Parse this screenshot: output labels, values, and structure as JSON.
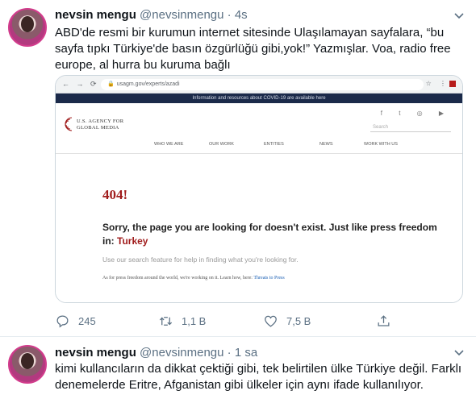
{
  "tweets": [
    {
      "name": "nevsin mengu",
      "handle": "@nevsinmengu",
      "separator": "·",
      "time": "4s",
      "text": "ABD'de resmi bir kurumun internet sitesinde Ulaşılamayan sayfalara, “bu sayfa tıpkı Türkiye'de basın özgürlüğü gibi,yok!” Yazmışlar. Voa, radio free europe, al hurra bu kuruma bağlı",
      "actions": {
        "reply_count": "245",
        "retweet_count": "1,1 B",
        "like_count": "7,5 B"
      },
      "embedded_screenshot": {
        "url": "usagm.gov/experts/azadi",
        "covid_banner": "Information and resources about COVID-19 are available here",
        "logo_line1": "U.S. AGENCY FOR",
        "logo_line2": "GLOBAL MEDIA",
        "search_placeholder": "Search",
        "nav": [
          "WHO WE ARE",
          "OUR WORK",
          "ENTITIES",
          "NEWS",
          "WORK WITH US"
        ],
        "error_code": "404!",
        "error_message": "Sorry, the page you are looking for doesn't exist. Just like press freedom in:",
        "error_country": "Turkey",
        "help_text": "Use our search feature for help in finding what you're looking for.",
        "note_text": "As for press freedom around the world, we're working on it. Learn how, here:",
        "note_link": "Threats to Press",
        "accent_color": "#a01c1c"
      }
    },
    {
      "name": "nevsin mengu",
      "handle": "@nevsinmengu",
      "separator": "·",
      "time": "1 sa",
      "text": "kimi kullancıların da dikkat çektiği gibi, tek belirtilen ülke Türkiye değil. Farklı denemelerde Eritre, Afganistan gibi ülkeler için aynı ifade kullanılıyor."
    }
  ]
}
